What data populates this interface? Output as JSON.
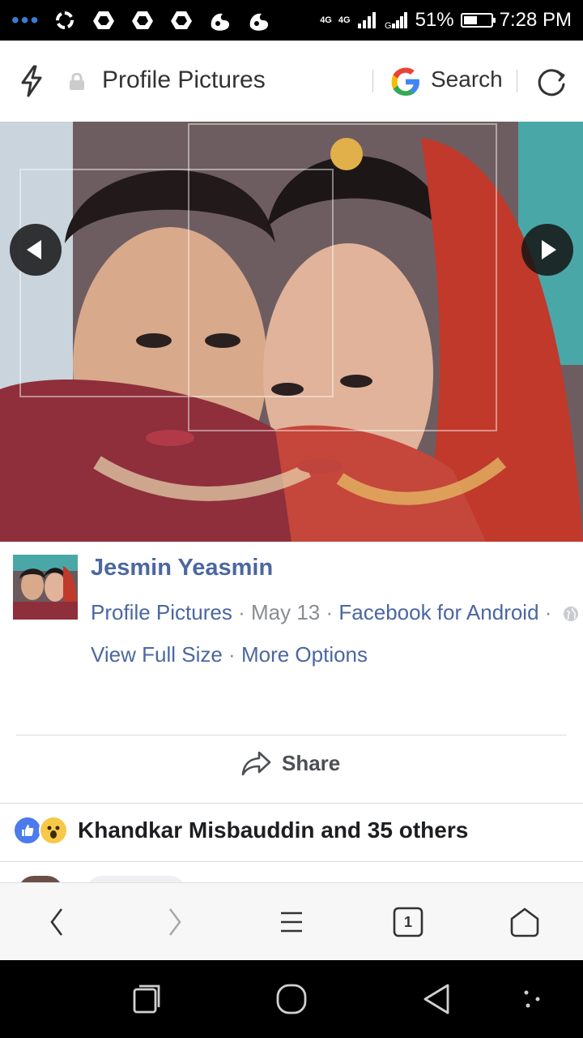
{
  "status_bar": {
    "network_top": "4G",
    "network_sub": "4G",
    "battery_percent": "51%",
    "battery_level": 0.51,
    "time": "7:28 PM"
  },
  "url_bar": {
    "title": "Profile Pictures",
    "search_label": "Search"
  },
  "post": {
    "author": "Jesmin Yeasmin",
    "album_link": "Profile Pictures",
    "separator": "·",
    "date": "May 13",
    "source_link": "Facebook for Android",
    "view_full_size": "View Full Size",
    "more_options": "More Options"
  },
  "actions": {
    "share_label": "Share"
  },
  "reactions": {
    "summary": "Khandkar Misbauddin and 35 others"
  },
  "browser_bar": {
    "tab_count": "1"
  },
  "colors": {
    "link_blue": "#4b67a1",
    "meta_gray": "#8a8d91",
    "like_blue": "#4b7bec"
  }
}
